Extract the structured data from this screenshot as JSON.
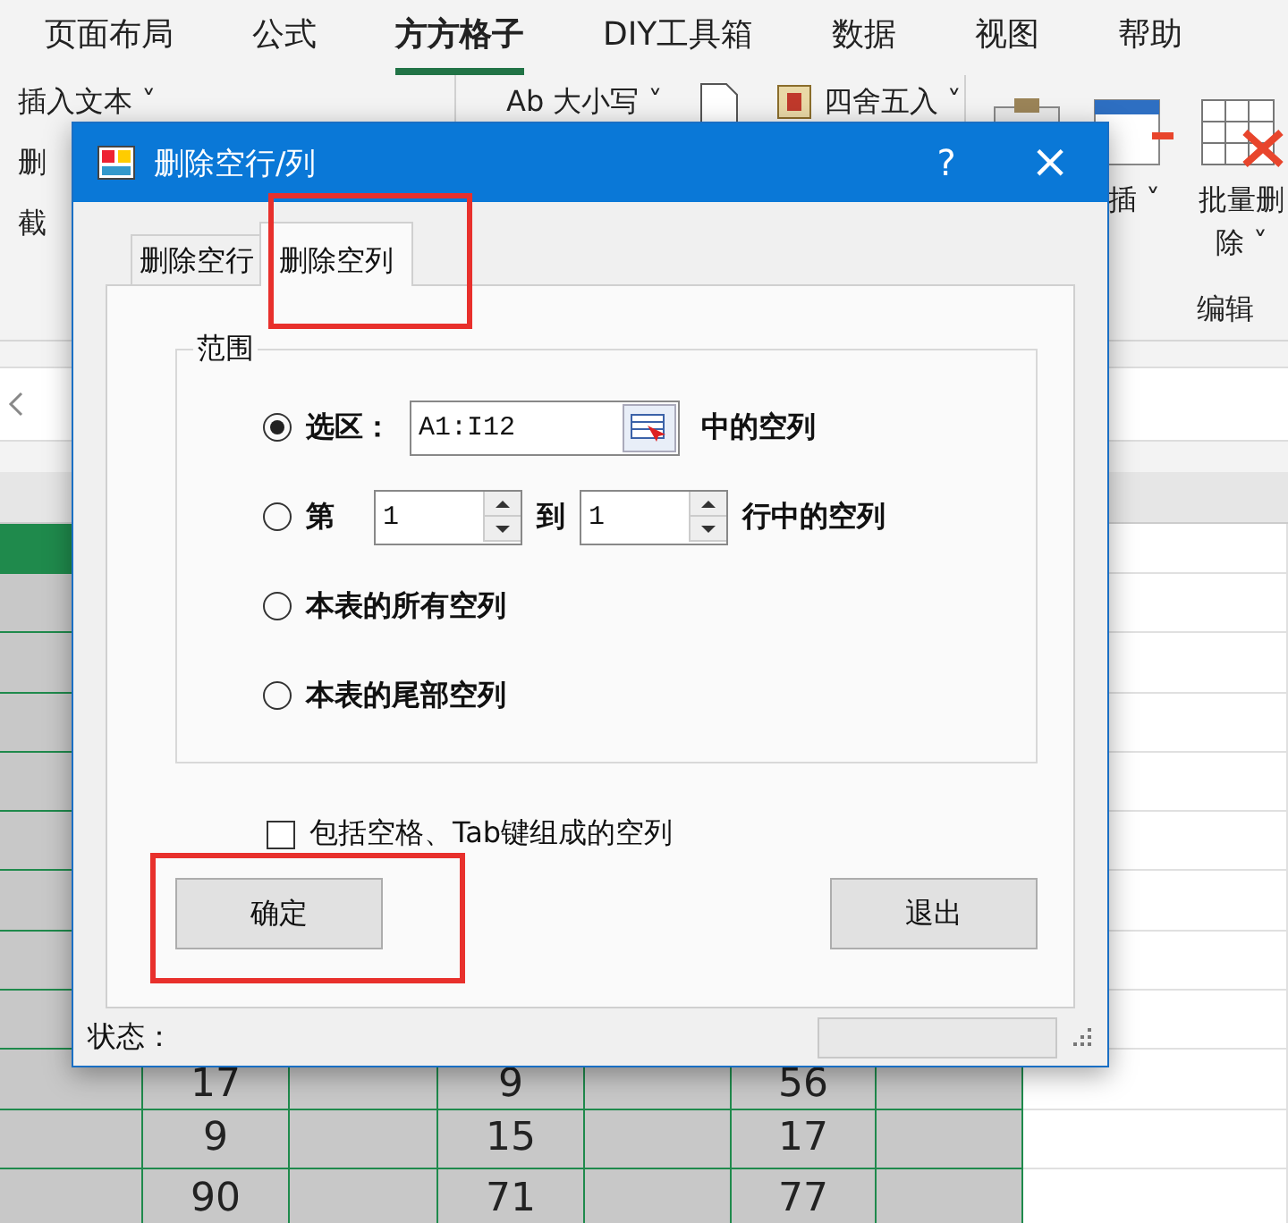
{
  "ribbon": {
    "tabs": [
      {
        "label": "页面布局",
        "selected": false
      },
      {
        "label": "公式",
        "selected": false
      },
      {
        "label": "方方格子",
        "selected": true
      },
      {
        "label": "DIY工具箱",
        "selected": false
      },
      {
        "label": "数据",
        "selected": false
      },
      {
        "label": "视图",
        "selected": false
      },
      {
        "label": "帮助",
        "selected": false
      }
    ],
    "left_commands": [
      "插入文本 ˅",
      "删",
      "截"
    ],
    "middle_commands": [
      "Ab 大小写 ˅",
      "四舍五入 ˅"
    ],
    "right_commands": [
      "插 ˅",
      "批量删除 ˅"
    ],
    "group_label": "编辑"
  },
  "sheet": {
    "rows": [
      [
        "17",
        "9",
        "56"
      ],
      [
        "9",
        "15",
        "17"
      ],
      [
        "90",
        "71",
        "77"
      ]
    ]
  },
  "dialog": {
    "title": "删除空行/列",
    "help": "?",
    "close": "×",
    "tabs": [
      {
        "label": "删除空行",
        "selected": false
      },
      {
        "label": "删除空列",
        "selected": true
      }
    ],
    "group": "范围",
    "options": [
      {
        "kind": "selection",
        "selected": true,
        "label": "选区：",
        "value": "A1:I12",
        "suffix": "中的空列"
      },
      {
        "kind": "row_range",
        "selected": false,
        "label": "第",
        "from": "1",
        "middle": "到",
        "to": "1",
        "suffix": "行中的空列"
      },
      {
        "kind": "plain",
        "selected": false,
        "label": "本表的所有空列"
      },
      {
        "kind": "plain",
        "selected": false,
        "label": "本表的尾部空列"
      }
    ],
    "checkbox": {
      "label": "包括空格、Tab键组成的空列",
      "checked": false
    },
    "buttons": [
      "确定",
      "退出"
    ],
    "status_label": "状态："
  }
}
